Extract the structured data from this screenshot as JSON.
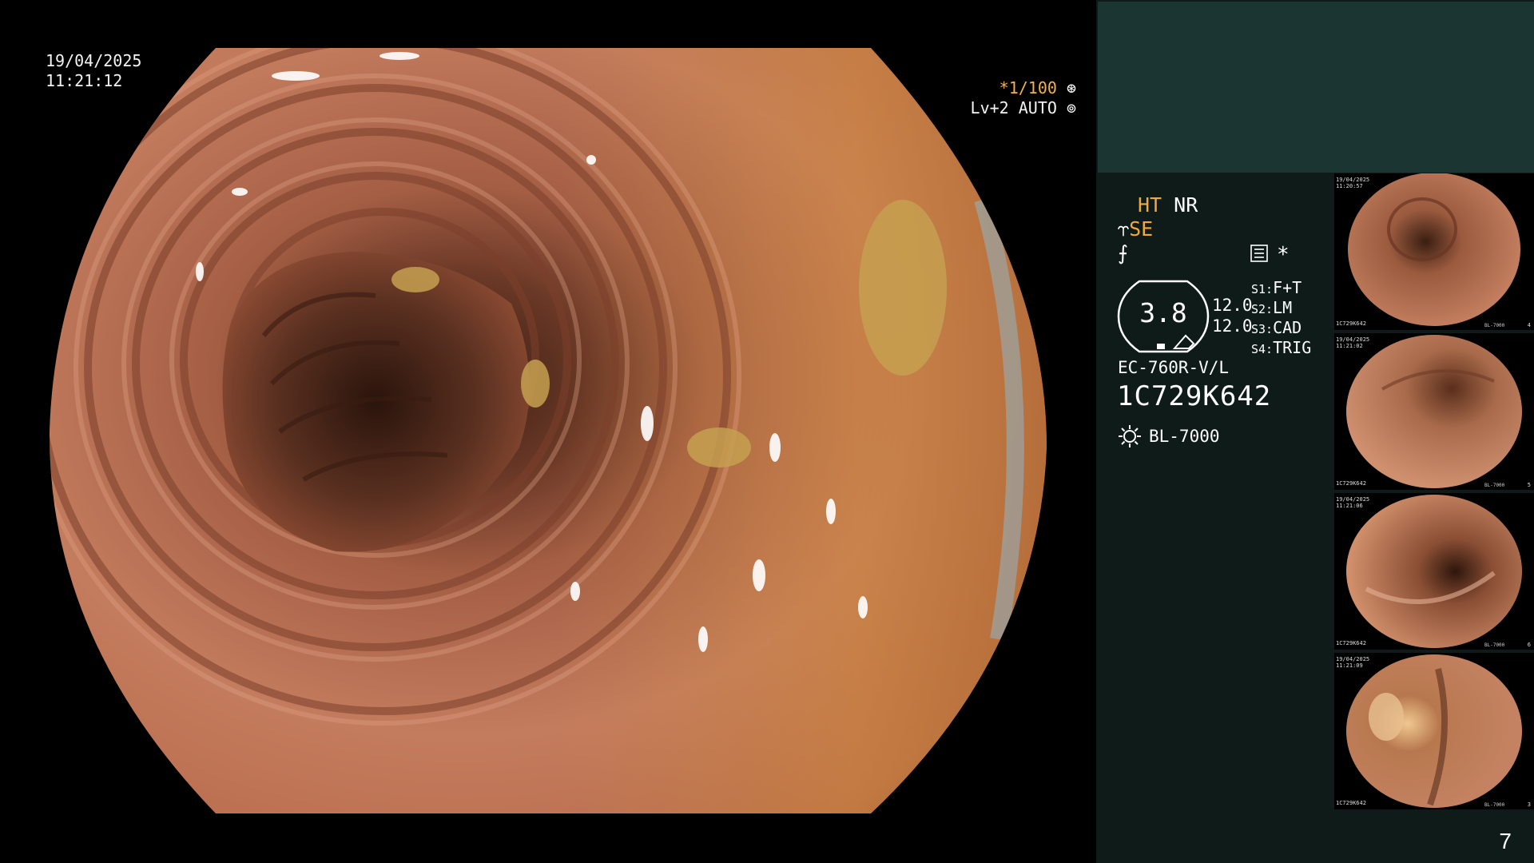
{
  "osd": {
    "date": "19/04/2025",
    "time": "11:21:12",
    "shutter": "*1/100",
    "iris": "Lv+2 AUTO"
  },
  "panel": {
    "ht": "HT",
    "nr": "NR",
    "se": "SE",
    "gauge_value": "3.8",
    "num1": "12.0",
    "num2": "12.0",
    "star": "*",
    "switches": [
      {
        "key": "S1:",
        "value": "F+T"
      },
      {
        "key": "S2:",
        "value": "LM"
      },
      {
        "key": "S3:",
        "value": "CAD"
      },
      {
        "key": "S4:",
        "value": "TRIG"
      }
    ],
    "scope_model": "EC-760R-V/L",
    "scope_serial": "1C729K642",
    "light_source": "BL-7000",
    "page_number": "7"
  },
  "thumbnails": [
    {
      "date": "19/04/2025",
      "time": "11:20:57",
      "serial": "1C729K642",
      "light": "BL-7000",
      "index": "4"
    },
    {
      "date": "19/04/2025",
      "time": "11:21:02",
      "serial": "1C729K642",
      "light": "BL-7000",
      "index": "5"
    },
    {
      "date": "19/04/2025",
      "time": "11:21:06",
      "serial": "1C729K642",
      "light": "BL-7000",
      "index": "6"
    },
    {
      "date": "19/04/2025",
      "time": "11:21:09",
      "serial": "1C729K642",
      "light": "BL-7000",
      "index": "3"
    }
  ],
  "colors": {
    "indicator_orange": "#f2a93a",
    "panel_bg": "#0e1b19",
    "panel_header": "#1b3632",
    "mucosa": "#c9835f"
  }
}
